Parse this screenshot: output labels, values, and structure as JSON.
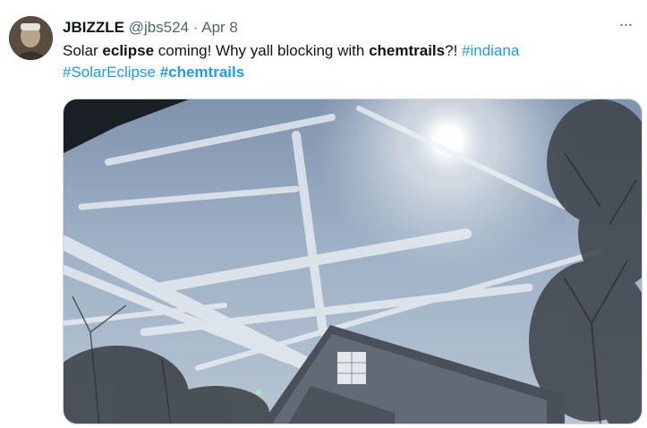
{
  "tweet": {
    "author_name": "JBIZZLE",
    "author_handle": "@jbs524",
    "separator": "·",
    "date": "Apr 8",
    "text_parts": {
      "p1": "Solar ",
      "p2": "eclipse",
      "p3": " coming! Why yall blocking with ",
      "p4": "chemtrails",
      "p5": "?! "
    },
    "hashtags": {
      "indiana": "#indiana",
      "solar_eclipse": "#SolarEclipse",
      "chemtrails": "#chemtrails"
    },
    "more_label": "···",
    "icons": {
      "more": "more-horizontal-icon",
      "avatar": "user-avatar"
    },
    "colors": {
      "link": "#1d9bf0",
      "secondary_text": "#536471",
      "text": "#0f1419"
    }
  }
}
